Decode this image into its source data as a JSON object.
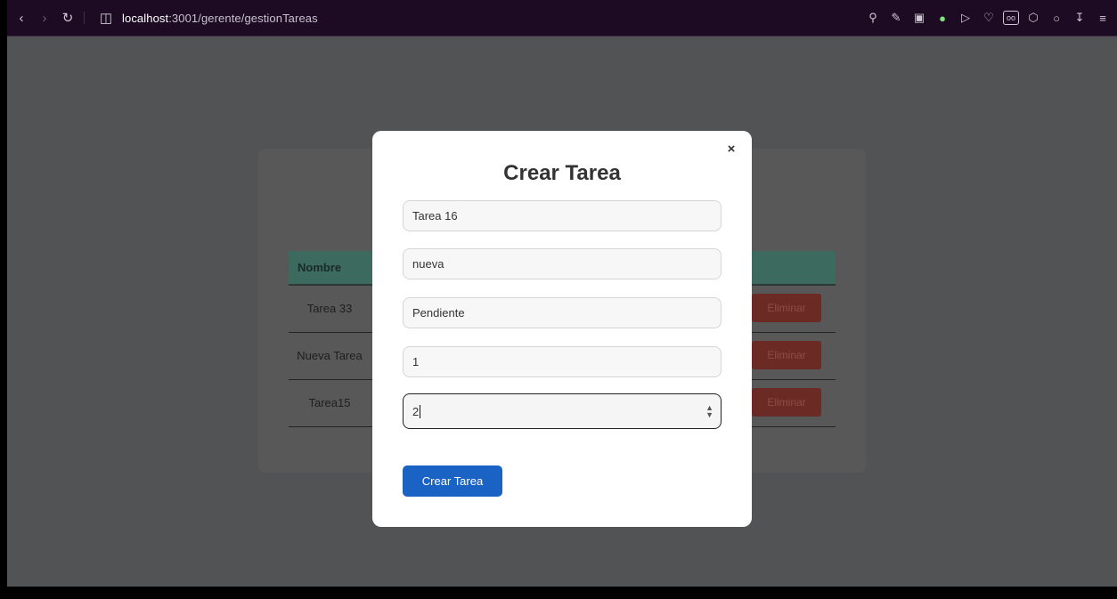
{
  "browser": {
    "url_host": "localhost",
    "url_path": ":3001/gerente/gestionTareas"
  },
  "table": {
    "header_name": "Nombre",
    "rows": [
      {
        "name": "Tarea 33",
        "action": "Eliminar"
      },
      {
        "name": "Nueva Tarea",
        "action": "Eliminar"
      },
      {
        "name": "Tarea15",
        "action": "Eliminar"
      }
    ]
  },
  "modal": {
    "title": "Crear Tarea",
    "close": "×",
    "fields": {
      "nombre": "Tarea 16",
      "descripcion": "nueva",
      "estado": "Pendiente",
      "campo4": "1",
      "campo5": "2"
    },
    "submit_label": "Crear Tarea"
  },
  "colors": {
    "primary": "#1a63c4",
    "table_header": "#3d6a5e",
    "delete": "#6c2a24"
  }
}
